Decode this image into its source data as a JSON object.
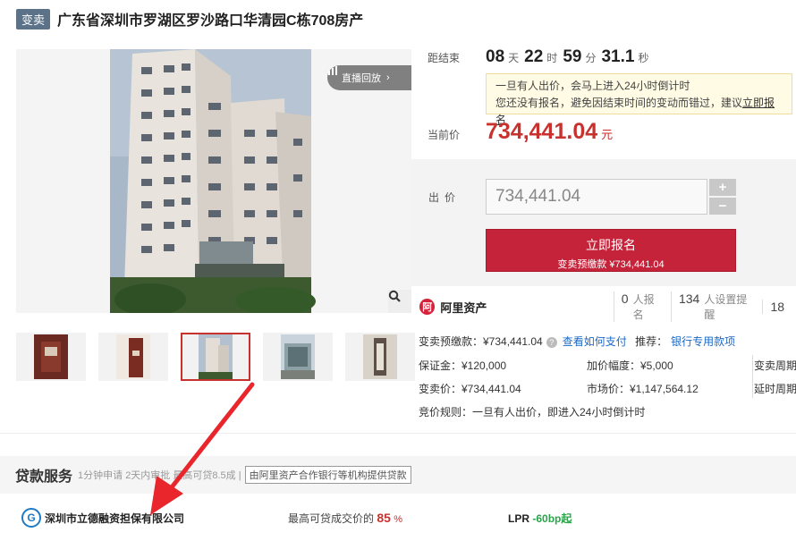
{
  "header": {
    "tag": "变卖",
    "title": "广东省深圳市罗湖区罗沙路口华清园C栋708房产"
  },
  "gallery": {
    "replay_label": "直播回放",
    "thumb_count": 5,
    "active_thumb": 2
  },
  "countdown": {
    "label": "距结束",
    "days": "08",
    "days_unit": "天",
    "hours": "22",
    "hours_unit": "时",
    "minutes": "59",
    "minutes_unit": "分",
    "seconds": "31.1",
    "seconds_unit": "秒"
  },
  "notice": {
    "line1": "一旦有人出价，会马上进入24小时倒计时",
    "line2_prefix": "您还没有报名，避免因结束时间的变动而错过，建议",
    "line2_link": "立即报名"
  },
  "price": {
    "label": "当前价",
    "value": "734,441.04",
    "unit": "元"
  },
  "bid": {
    "label": "出价",
    "value": "734,441.04",
    "plus": "+",
    "minus": "−",
    "signup_label": "立即报名",
    "signup_sub": "变卖预缴款 ¥734,441.04"
  },
  "ali": {
    "logo": "阿",
    "name": "阿里资产",
    "stats": [
      {
        "num": "0",
        "label": "人报名"
      },
      {
        "num": "134",
        "label": "人设置提醒"
      },
      {
        "num": "18",
        "label": ""
      }
    ]
  },
  "info": {
    "deposit": "变卖预缴款：¥734,441.04",
    "how_pay": "查看如何支付",
    "recommend": "推荐：",
    "bank_loan": "银行专用款项",
    "guarantee": "保证金：¥120,000",
    "increment": "加价幅度：¥5,000",
    "period": "变卖周期",
    "sale_price": "变卖价：¥734,441.04",
    "market_price": "市场价：¥1,147,564.12",
    "delay": "延时周期",
    "rule": "竞价规则：一旦有人出价，即进入24小时倒计时"
  },
  "loan": {
    "title": "贷款服务",
    "sub": "1分钟申请 2天内审批 最高可贷8.5成 |",
    "tag": "由阿里资产合作银行等机构提供贷款"
  },
  "lender": {
    "logo": "G",
    "name": "深圳市立德融资担保有限公司",
    "max_label": "最高可贷成交价的",
    "max_pct": "85",
    "pct_sign": "%",
    "lpr_label": "LPR",
    "lpr_value": "-60bp起"
  },
  "colors": {
    "accent": "#c8322e",
    "button": "#c5233a",
    "link": "#1a68c8",
    "tag_bg": "#5b7288"
  }
}
